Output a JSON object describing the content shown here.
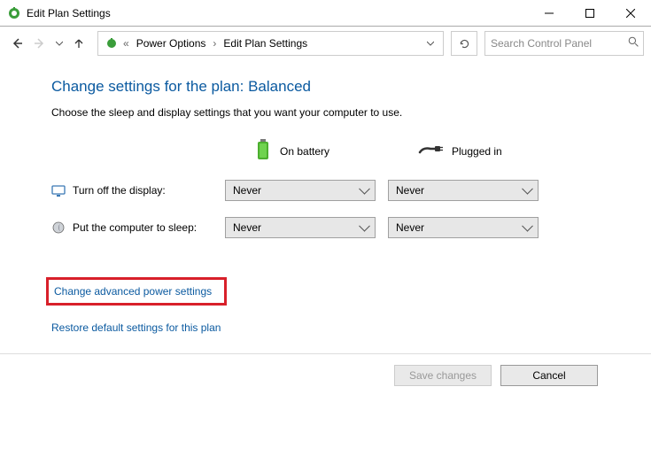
{
  "window": {
    "title": "Edit Plan Settings"
  },
  "breadcrumb": {
    "a": "Power Options",
    "b": "Edit Plan Settings"
  },
  "search": {
    "placeholder": "Search Control Panel"
  },
  "page": {
    "title": "Change settings for the plan: Balanced",
    "subtitle": "Choose the sleep and display settings that you want your computer to use."
  },
  "columns": {
    "battery": "On battery",
    "plugged": "Plugged in"
  },
  "rows": {
    "display": {
      "label": "Turn off the display:",
      "battery": "Never",
      "plugged": "Never"
    },
    "sleep": {
      "label": "Put the computer to sleep:",
      "battery": "Never",
      "plugged": "Never"
    }
  },
  "links": {
    "advanced": "Change advanced power settings",
    "restore": "Restore default settings for this plan"
  },
  "buttons": {
    "save": "Save changes",
    "cancel": "Cancel"
  }
}
